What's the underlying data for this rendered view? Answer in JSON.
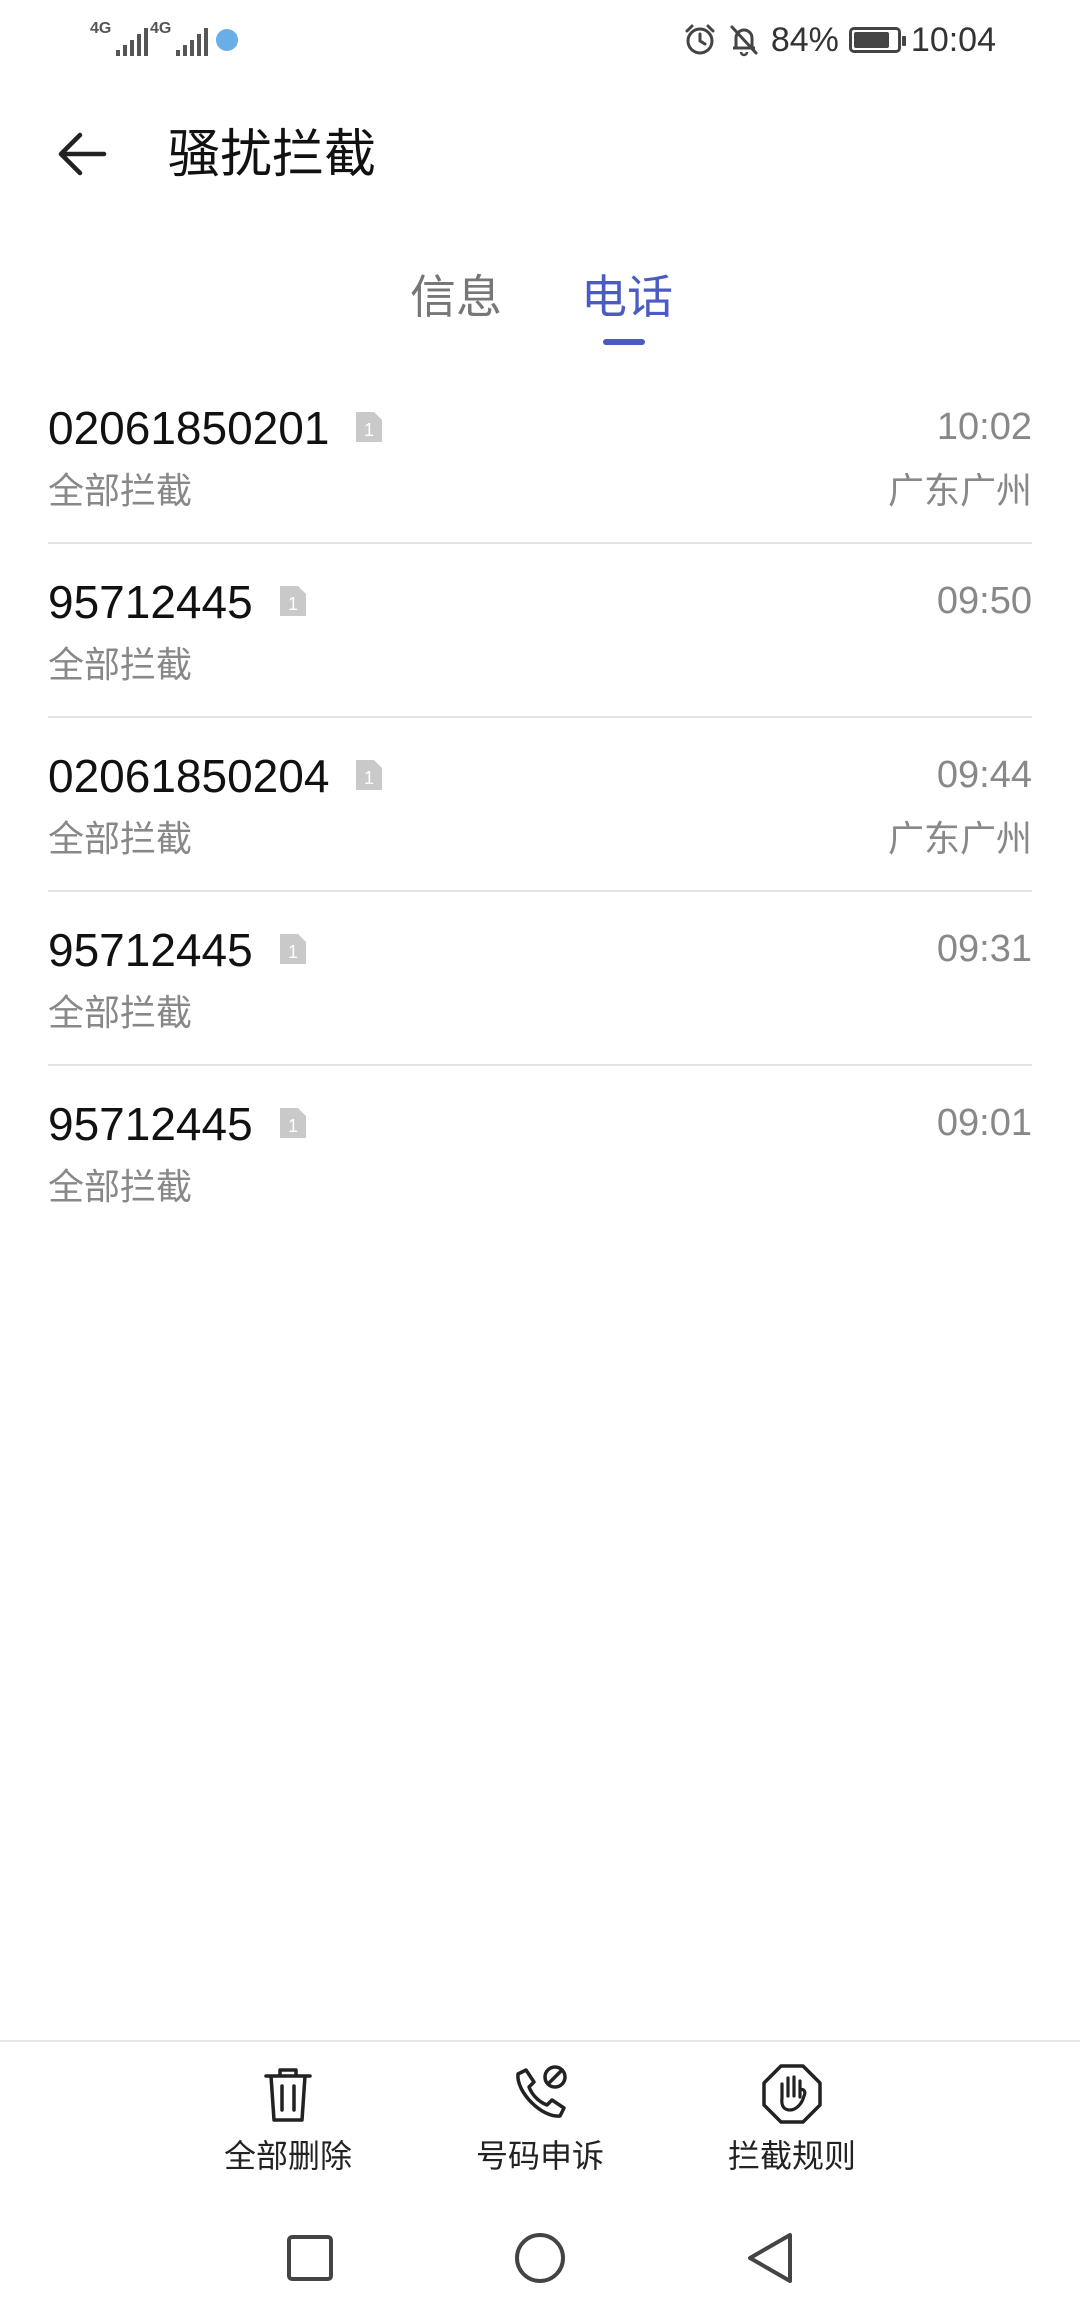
{
  "status_bar": {
    "network1": "4G",
    "network2": "4G",
    "alarm_icon": "alarm-clock-icon",
    "mute_icon": "bell-off-icon",
    "battery": "84%",
    "time": "10:04"
  },
  "header": {
    "back_icon": "arrow-left-icon",
    "title": "骚扰拦截"
  },
  "tabs": [
    {
      "label": "信息",
      "active": false
    },
    {
      "label": "电话",
      "active": true
    }
  ],
  "accent_color": "#4a5bc4",
  "calls": [
    {
      "number": "02061850201",
      "sim": "1",
      "status": "全部拦截",
      "time": "10:02",
      "location": "广东广州"
    },
    {
      "number": "95712445",
      "sim": "1",
      "status": "全部拦截",
      "time": "09:50",
      "location": ""
    },
    {
      "number": "02061850204",
      "sim": "1",
      "status": "全部拦截",
      "time": "09:44",
      "location": "广东广州"
    },
    {
      "number": "95712445",
      "sim": "1",
      "status": "全部拦截",
      "time": "09:31",
      "location": ""
    },
    {
      "number": "95712445",
      "sim": "1",
      "status": "全部拦截",
      "time": "09:01",
      "location": ""
    }
  ],
  "toolbar": {
    "delete_all": {
      "label": "全部删除",
      "icon": "trash-icon"
    },
    "appeal": {
      "label": "号码申诉",
      "icon": "phone-blocked-icon"
    },
    "rules": {
      "label": "拦截规则",
      "icon": "hand-stop-icon"
    }
  },
  "nav": {
    "recent": "square-icon",
    "home": "circle-icon",
    "back": "triangle-back-icon"
  }
}
